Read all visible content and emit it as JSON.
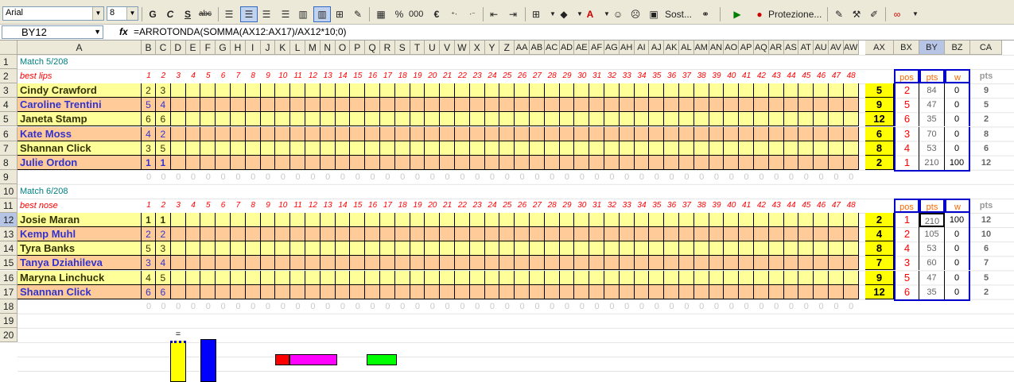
{
  "toolbar": {
    "font_name": "Arial",
    "font_size": "8",
    "bold": "G",
    "italic": "C",
    "underline": "S",
    "strike": "abc",
    "percent": "%",
    "thousands": "000",
    "euro": "€",
    "find_label": "Sost...",
    "protect_label": "Protezione..."
  },
  "formula_bar": {
    "cell_ref": "BY12",
    "fx": "fx",
    "formula": "=ARROTONDA(SOMMA(AX12:AX17)/AX12*10;0)"
  },
  "columns": [
    "A",
    "B",
    "C",
    "D",
    "E",
    "F",
    "G",
    "H",
    "I",
    "J",
    "K",
    "L",
    "M",
    "N",
    "O",
    "P",
    "Q",
    "R",
    "S",
    "T",
    "U",
    "V",
    "W",
    "X",
    "Y",
    "Z",
    "AA",
    "AB",
    "AC",
    "AD",
    "AE",
    "AF",
    "AG",
    "AH",
    "AI",
    "AJ",
    "AK",
    "AL",
    "AM",
    "AN",
    "AO",
    "AP",
    "AQ",
    "AR",
    "AS",
    "AT",
    "AU",
    "AV",
    "AW",
    "AX",
    "BX",
    "BY",
    "BZ",
    "CA"
  ],
  "selected_column": "BY",
  "selected_row": "12",
  "rows": [
    "1",
    "2",
    "3",
    "4",
    "5",
    "6",
    "7",
    "8",
    "9",
    "10",
    "11",
    "12",
    "13",
    "14",
    "15",
    "16",
    "17",
    "18",
    "19",
    "20"
  ],
  "index_numbers": [
    "1",
    "2",
    "3",
    "4",
    "5",
    "6",
    "7",
    "8",
    "9",
    "10",
    "11",
    "12",
    "13",
    "14",
    "15",
    "16",
    "17",
    "18",
    "19",
    "20",
    "21",
    "22",
    "23",
    "24",
    "25",
    "26",
    "27",
    "28",
    "29",
    "30",
    "31",
    "32",
    "33",
    "34",
    "35",
    "36",
    "37",
    "38",
    "39",
    "40",
    "41",
    "42",
    "43",
    "44",
    "45",
    "46",
    "47",
    "48"
  ],
  "zero_value": "0",
  "stat_headers": {
    "pos": "pos",
    "pts": "pts",
    "w": "w",
    "total": "pts"
  },
  "equals_mark": "=",
  "sections": [
    {
      "match": "Match 5/208",
      "category": "best lips",
      "players": [
        {
          "name": "Cindy Crawford",
          "b": "2",
          "c": "3",
          "ax": "5",
          "pos": "2",
          "pts": "84",
          "w": "0",
          "total": "9"
        },
        {
          "name": "Caroline Trentini",
          "b": "5",
          "c": "4",
          "ax": "9",
          "pos": "5",
          "pts": "47",
          "w": "0",
          "total": "5"
        },
        {
          "name": "Janeta Stamp",
          "b": "6",
          "c": "6",
          "ax": "12",
          "pos": "6",
          "pts": "35",
          "w": "0",
          "total": "2"
        },
        {
          "name": "Kate Moss",
          "b": "4",
          "c": "2",
          "ax": "6",
          "pos": "3",
          "pts": "70",
          "w": "0",
          "total": "8"
        },
        {
          "name": "Shannan Click",
          "b": "3",
          "c": "5",
          "ax": "8",
          "pos": "4",
          "pts": "53",
          "w": "0",
          "total": "6"
        },
        {
          "name": "Julie Ordon",
          "b": "1",
          "c": "1",
          "ax": "2",
          "pos": "1",
          "pts": "210",
          "w": "100",
          "total": "12"
        }
      ]
    },
    {
      "match": "Match 6/208",
      "category": "best nose",
      "players": [
        {
          "name": "Josie Maran",
          "b": "1",
          "c": "1",
          "ax": "2",
          "pos": "1",
          "pts": "210",
          "w": "100",
          "total": "12"
        },
        {
          "name": "Kemp Muhl",
          "b": "2",
          "c": "2",
          "ax": "4",
          "pos": "2",
          "pts": "105",
          "w": "0",
          "total": "10"
        },
        {
          "name": "Tyra Banks",
          "b": "5",
          "c": "3",
          "ax": "8",
          "pos": "4",
          "pts": "53",
          "w": "0",
          "total": "6"
        },
        {
          "name": "Tanya Dziahileva",
          "b": "3",
          "c": "4",
          "ax": "7",
          "pos": "3",
          "pts": "60",
          "w": "0",
          "total": "7"
        },
        {
          "name": "Maryna Linchuck",
          "b": "4",
          "c": "5",
          "ax": "9",
          "pos": "5",
          "pts": "47",
          "w": "0",
          "total": "5"
        },
        {
          "name": "Shannan Click",
          "b": "6",
          "c": "6",
          "ax": "12",
          "pos": "6",
          "pts": "35",
          "w": "0",
          "total": "2"
        }
      ]
    }
  ],
  "colors": {
    "yellow_row": "#ffff99",
    "orange_row": "#ffcc99",
    "name_dark": "#333300",
    "name_blue": "#3333cc",
    "ax_fill": "#ffff00",
    "pos_red": "#ff0000",
    "selection_blue": "#0000cc",
    "bar_yellow": "#ffff00",
    "bar_blue": "#0000ff",
    "bar_magenta": "#ff00ff",
    "bar_green": "#00ff00",
    "bar_red": "#ff0000"
  }
}
